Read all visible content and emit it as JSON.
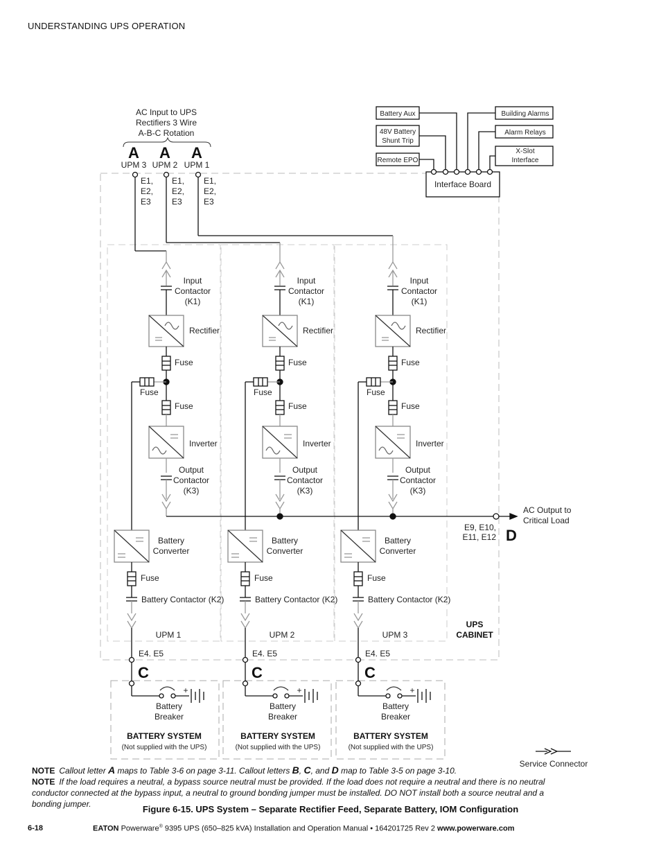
{
  "header": {
    "section_title": "UNDERSTANDING UPS OPERATION"
  },
  "diagram": {
    "ac_input_label": [
      "AC Input to UPS",
      "Rectifiers 3 Wire",
      "A-B-C Rotation"
    ],
    "callout_a": "A",
    "callout_c": "C",
    "callout_d": "D",
    "input_terminals": [
      {
        "upm": "UPM  3",
        "terminals": [
          "E1,",
          "E2,",
          "E3"
        ]
      },
      {
        "upm": "UPM  2",
        "terminals": [
          "E1,",
          "E2,",
          "E3"
        ]
      },
      {
        "upm": "UPM  1",
        "terminals": [
          "E1,",
          "E2,",
          "E3"
        ]
      }
    ],
    "interface": {
      "board_label": "Interface Board",
      "left_boxes": [
        "Battery Aux",
        "48V Battery|Shunt Trip",
        "Remote EPO"
      ],
      "right_boxes": [
        "Building Alarms",
        "Alarm Relays",
        "X-Slot|Interface"
      ]
    },
    "upms": [
      {
        "name": "UPM 1"
      },
      {
        "name": "UPM 2"
      },
      {
        "name": "UPM 3"
      }
    ],
    "component_labels": {
      "input_contactor": [
        "Input",
        "Contactor",
        "(K1)"
      ],
      "rectifier": "Rectifier",
      "fuse": "Fuse",
      "inverter": "Inverter",
      "output_contactor": [
        "Output",
        "Contactor",
        "(K3)"
      ],
      "battery_converter": [
        "Battery",
        "Converter"
      ],
      "battery_contactor": "Battery Contactor (K2)",
      "battery_terminals": "E4. E5",
      "battery_breaker": [
        "Battery",
        "Breaker"
      ],
      "battery_system": "BATTERY SYSTEM",
      "battery_system_note": "(Not supplied with the UPS)"
    },
    "ac_output_label": [
      "AC Output to",
      "Critical Load"
    ],
    "output_terminals": [
      "E9, E10,",
      "E11, E12"
    ],
    "ups_cabinet_label": [
      "UPS",
      "CABINET"
    ],
    "service_connector_label": "Service Connector"
  },
  "notes": [
    {
      "label": "NOTE",
      "text_parts": [
        "Callout letter ",
        "A",
        " maps to Table 3-6 on page 3-11. Callout letters ",
        "B",
        ", ",
        "C",
        ", and ",
        "D",
        " map to Table 3-5 on page 3-10."
      ]
    },
    {
      "label": "NOTE",
      "text": "If the load requires a neutral, a bypass source neutral must be provided. If the load does not require a neutral and there is no neutral conductor connected at the bypass input, a neutral to ground bonding jumper must be installed. DO NOT install both a source neutral and a bonding jumper."
    }
  ],
  "caption": "Figure 6-15. UPS System – Separate Rectifier Feed, Separate Battery, IOM Configuration",
  "footer": {
    "page_number": "6-18",
    "brand": "EATON",
    "product": "Powerware",
    "reg": "®",
    "manual": " 9395 UPS (650–825 kVA) Installation and Operation Manual  •  164201725 Rev 2 ",
    "url": "www.powerware.com"
  }
}
